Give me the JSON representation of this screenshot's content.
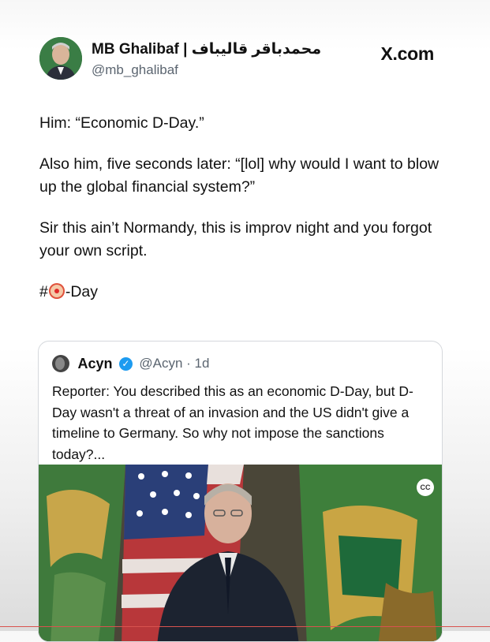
{
  "tweet": {
    "author_name": "MB Ghalibaf | محمدباقر قالیباف",
    "author_handle": "@mb_ghalibaf",
    "source": "X.com",
    "paragraphs": [
      "Him: “Economic D-Day.”",
      "Also him, five seconds later: “[lol] why would I want to blow up the global financial system?”",
      "Sir this ain’t Normandy, this is improv night and you forgot your own script."
    ],
    "hashtag_prefix": "#",
    "hashtag_suffix": "-Day",
    "hashtag_icon": "clown-face-icon"
  },
  "quoted": {
    "author_name": "Acyn",
    "author_handle": "@Acyn · 1d",
    "verified_icon": "verified-badge-icon",
    "text": "Reporter: You described this as an economic D-Day, but D-Day wasn't a threat of an invasion and the US didn't give a timeline to Germany. So why not impose the sanctions today?...",
    "media_badge": "CC"
  },
  "colors": {
    "verified": "#1d9bf0",
    "handle": "#5b6570",
    "accent_line": "#d9534f"
  }
}
